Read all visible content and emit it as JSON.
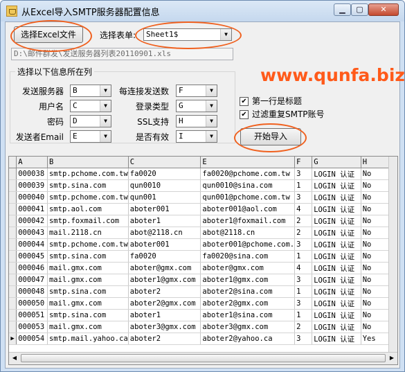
{
  "window": {
    "title": "从Excel导入SMTP服务器配置信息",
    "min_glyph": "▁",
    "max_glyph": "▢",
    "close_glyph": "✕"
  },
  "toolbar": {
    "select_excel_label": "选择Excel文件",
    "sheet_label": "选择表单:",
    "sheet_value": "Sheet1$",
    "file_path": "D:\\邮件群发\\发送服务器列表20110901.xls"
  },
  "mapping": {
    "legend": "选择以下信息所在列",
    "fields": [
      {
        "label": "发送服务器",
        "value": "B"
      },
      {
        "label": "用户名",
        "value": "C"
      },
      {
        "label": "密码",
        "value": "D"
      },
      {
        "label": "发送者Email",
        "value": "E"
      },
      {
        "label": "每连接发送数",
        "value": "F"
      },
      {
        "label": "登录类型",
        "value": "G"
      },
      {
        "label": "SSL支持",
        "value": "H"
      },
      {
        "label": "是否有效",
        "value": "I"
      }
    ]
  },
  "options": {
    "first_row_title": "第一行是标题",
    "filter_duplicates": "过滤重复SMTP账号",
    "first_row_checked": true,
    "filter_checked": true,
    "check_glyph": "✔"
  },
  "start_button": "开始导入",
  "watermark": "www.qunfa.biz",
  "grid": {
    "columns": [
      "A",
      "B",
      "C",
      "E",
      "F",
      "G",
      "H"
    ],
    "rows": [
      [
        "000038",
        "smtp.pchome.com.tw",
        "fa0020",
        "fa0020@pchome.com.tw",
        "3",
        "LOGIN 认证",
        "No"
      ],
      [
        "000039",
        "smtp.sina.com",
        "qun0010",
        "qun0010@sina.com",
        "1",
        "LOGIN 认证",
        "No"
      ],
      [
        "000040",
        "smtp.pchome.com.tw",
        "qun001",
        "qun001@pchome.com.tw",
        "3",
        "LOGIN 认证",
        "No"
      ],
      [
        "000041",
        "smtp.aol.com",
        "aboter001",
        "aboter001@aol.com",
        "4",
        "LOGIN 认证",
        "No"
      ],
      [
        "000042",
        "smtp.foxmail.com",
        "aboter1",
        "aboter1@foxmail.com",
        "2",
        "LOGIN 认证",
        "No"
      ],
      [
        "000043",
        "mail.2118.cn",
        "abot@2118.cn",
        "abot@2118.cn",
        "2",
        "LOGIN 认证",
        "No"
      ],
      [
        "000044",
        "smtp.pchome.com.tw",
        "aboter001",
        "aboter001@pchome.com.",
        "3",
        "LOGIN 认证",
        "No"
      ],
      [
        "000045",
        "smtp.sina.com",
        "fa0020",
        "fa0020@sina.com",
        "1",
        "LOGIN 认证",
        "No"
      ],
      [
        "000046",
        "mail.gmx.com",
        "aboter@gmx.com",
        "aboter@gmx.com",
        "4",
        "LOGIN 认证",
        "No"
      ],
      [
        "000047",
        "mail.gmx.com",
        "aboter1@gmx.com",
        "aboter1@gmx.com",
        "3",
        "LOGIN 认证",
        "No"
      ],
      [
        "000048",
        "smtp.sina.com",
        "aboter2",
        "aboter2@sina.com",
        "1",
        "LOGIN 认证",
        "No"
      ],
      [
        "000050",
        "mail.gmx.com",
        "aboter2@gmx.com",
        "aboter2@gmx.com",
        "3",
        "LOGIN 认证",
        "No"
      ],
      [
        "000051",
        "smtp.sina.com",
        "aboter1",
        "aboter1@sina.com",
        "1",
        "LOGIN 认证",
        "No"
      ],
      [
        "000053",
        "mail.gmx.com",
        "aboter3@gmx.com",
        "aboter3@gmx.com",
        "2",
        "LOGIN 认证",
        "No"
      ],
      [
        "000054",
        "smtp.mail.yahoo.ca",
        "aboter2",
        "aboter2@yahoo.ca",
        "3",
        "LOGIN 认证",
        "Yes"
      ]
    ],
    "current_row_marker": "▶",
    "scroll_left": "◀",
    "scroll_right": "▶"
  },
  "colors": {
    "annotation": "#f0601e",
    "watermark": "#ff5a1a"
  }
}
